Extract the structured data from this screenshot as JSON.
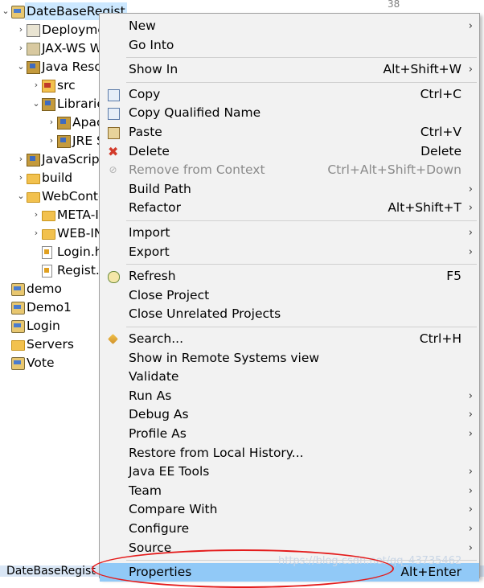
{
  "tree": {
    "rows": [
      {
        "name": "project-datebaseregist",
        "label": "DateBaseRegist",
        "indent": 0,
        "arrow": "⌄",
        "icon": "project"
      },
      {
        "name": "deployment-descriptor",
        "label": "Deployme",
        "indent": 1,
        "arrow": "›",
        "icon": "deploy"
      },
      {
        "name": "jax-ws",
        "label": "JAX-WS W",
        "indent": 1,
        "arrow": "›",
        "icon": "ws"
      },
      {
        "name": "java-resources",
        "label": "Java Resou",
        "indent": 1,
        "arrow": "⌄",
        "icon": "lib"
      },
      {
        "name": "src",
        "label": "src",
        "indent": 2,
        "arrow": "›",
        "icon": "src"
      },
      {
        "name": "libraries",
        "label": "Librarie",
        "indent": 2,
        "arrow": "⌄",
        "icon": "lib"
      },
      {
        "name": "apache",
        "label": "Apac",
        "indent": 3,
        "arrow": "›",
        "icon": "lib"
      },
      {
        "name": "jre",
        "label": "JRE S",
        "indent": 3,
        "arrow": "›",
        "icon": "lib"
      },
      {
        "name": "javascript",
        "label": "JavaScript",
        "indent": 1,
        "arrow": "›",
        "icon": "lib"
      },
      {
        "name": "build",
        "label": "build",
        "indent": 1,
        "arrow": "›",
        "icon": "folder"
      },
      {
        "name": "webcontent",
        "label": "WebConte",
        "indent": 1,
        "arrow": "⌄",
        "icon": "folder"
      },
      {
        "name": "meta-inf",
        "label": "META-I",
        "indent": 2,
        "arrow": "›",
        "icon": "folder"
      },
      {
        "name": "web-inf",
        "label": "WEB-IN",
        "indent": 2,
        "arrow": "›",
        "icon": "folder"
      },
      {
        "name": "login-file",
        "label": "Login.h",
        "indent": 2,
        "arrow": "",
        "icon": "file"
      },
      {
        "name": "regist-file",
        "label": "Regist.l",
        "indent": 2,
        "arrow": "",
        "icon": "file"
      },
      {
        "name": "project-demo",
        "label": "demo",
        "indent": 0,
        "arrow": "",
        "icon": "project"
      },
      {
        "name": "project-demo1",
        "label": "Demo1",
        "indent": 0,
        "arrow": "",
        "icon": "project"
      },
      {
        "name": "project-login",
        "label": "Login",
        "indent": 0,
        "arrow": "",
        "icon": "project"
      },
      {
        "name": "servers",
        "label": "Servers",
        "indent": 0,
        "arrow": "",
        "icon": "folder"
      },
      {
        "name": "project-vote",
        "label": "Vote",
        "indent": 0,
        "arrow": "",
        "icon": "project"
      }
    ]
  },
  "editor": {
    "line_number": "38"
  },
  "status": {
    "bottom_tab": "DateBaseRegist"
  },
  "menu": {
    "items": [
      {
        "type": "item",
        "name": "menu-new",
        "label": "New",
        "shortcut": "",
        "submenu": true,
        "icon": ""
      },
      {
        "type": "item",
        "name": "menu-go-into",
        "label": "Go Into",
        "shortcut": "",
        "submenu": false,
        "icon": ""
      },
      {
        "type": "sep"
      },
      {
        "type": "item",
        "name": "menu-show-in",
        "label": "Show In",
        "shortcut": "Alt+Shift+W",
        "submenu": true,
        "icon": ""
      },
      {
        "type": "sep"
      },
      {
        "type": "item",
        "name": "menu-copy",
        "label": "Copy",
        "shortcut": "Ctrl+C",
        "submenu": false,
        "icon": "copy"
      },
      {
        "type": "item",
        "name": "menu-copy-qualified-name",
        "label": "Copy Qualified Name",
        "shortcut": "",
        "submenu": false,
        "icon": "copy"
      },
      {
        "type": "item",
        "name": "menu-paste",
        "label": "Paste",
        "shortcut": "Ctrl+V",
        "submenu": false,
        "icon": "paste"
      },
      {
        "type": "item",
        "name": "menu-delete",
        "label": "Delete",
        "shortcut": "Delete",
        "submenu": false,
        "icon": "delete"
      },
      {
        "type": "item",
        "name": "menu-remove-from-context",
        "label": "Remove from Context",
        "shortcut": "Ctrl+Alt+Shift+Down",
        "submenu": false,
        "icon": "remove",
        "disabled": true
      },
      {
        "type": "item",
        "name": "menu-build-path",
        "label": "Build Path",
        "shortcut": "",
        "submenu": true,
        "icon": ""
      },
      {
        "type": "item",
        "name": "menu-refactor",
        "label": "Refactor",
        "shortcut": "Alt+Shift+T",
        "submenu": true,
        "icon": ""
      },
      {
        "type": "sep"
      },
      {
        "type": "item",
        "name": "menu-import",
        "label": "Import",
        "shortcut": "",
        "submenu": true,
        "icon": ""
      },
      {
        "type": "item",
        "name": "menu-export",
        "label": "Export",
        "shortcut": "",
        "submenu": true,
        "icon": ""
      },
      {
        "type": "sep"
      },
      {
        "type": "item",
        "name": "menu-refresh",
        "label": "Refresh",
        "shortcut": "F5",
        "submenu": false,
        "icon": "refresh"
      },
      {
        "type": "item",
        "name": "menu-close-project",
        "label": "Close Project",
        "shortcut": "",
        "submenu": false,
        "icon": ""
      },
      {
        "type": "item",
        "name": "menu-close-unrelated-projects",
        "label": "Close Unrelated Projects",
        "shortcut": "",
        "submenu": false,
        "icon": ""
      },
      {
        "type": "sep"
      },
      {
        "type": "item",
        "name": "menu-search",
        "label": "Search...",
        "shortcut": "Ctrl+H",
        "submenu": false,
        "icon": "search"
      },
      {
        "type": "item",
        "name": "menu-show-in-remote-systems",
        "label": "Show in Remote Systems view",
        "shortcut": "",
        "submenu": false,
        "icon": ""
      },
      {
        "type": "item",
        "name": "menu-validate",
        "label": "Validate",
        "shortcut": "",
        "submenu": false,
        "icon": ""
      },
      {
        "type": "item",
        "name": "menu-run-as",
        "label": "Run As",
        "shortcut": "",
        "submenu": true,
        "icon": ""
      },
      {
        "type": "item",
        "name": "menu-debug-as",
        "label": "Debug As",
        "shortcut": "",
        "submenu": true,
        "icon": ""
      },
      {
        "type": "item",
        "name": "menu-profile-as",
        "label": "Profile As",
        "shortcut": "",
        "submenu": true,
        "icon": ""
      },
      {
        "type": "item",
        "name": "menu-restore-local-history",
        "label": "Restore from Local History...",
        "shortcut": "",
        "submenu": false,
        "icon": ""
      },
      {
        "type": "item",
        "name": "menu-java-ee-tools",
        "label": "Java EE Tools",
        "shortcut": "",
        "submenu": true,
        "icon": ""
      },
      {
        "type": "item",
        "name": "menu-team",
        "label": "Team",
        "shortcut": "",
        "submenu": true,
        "icon": ""
      },
      {
        "type": "item",
        "name": "menu-compare-with",
        "label": "Compare With",
        "shortcut": "",
        "submenu": true,
        "icon": ""
      },
      {
        "type": "item",
        "name": "menu-configure",
        "label": "Configure",
        "shortcut": "",
        "submenu": true,
        "icon": ""
      },
      {
        "type": "item",
        "name": "menu-source",
        "label": "Source",
        "shortcut": "",
        "submenu": true,
        "icon": ""
      },
      {
        "type": "sep"
      },
      {
        "type": "item",
        "name": "menu-properties",
        "label": "Properties",
        "shortcut": "Alt+Enter",
        "submenu": false,
        "icon": "",
        "highlight": true
      }
    ]
  },
  "watermark": "https://blog.csdn.net/qq_43735462",
  "colors": {
    "highlight": "#91c9f7",
    "annotation": "#e41b1b",
    "selection": "#cce8ff"
  }
}
